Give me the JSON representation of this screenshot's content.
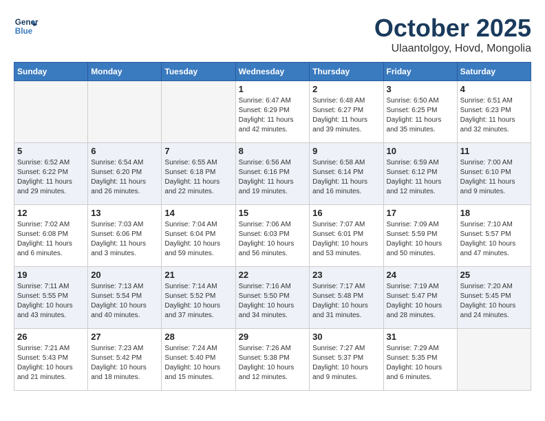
{
  "header": {
    "logo_line1": "General",
    "logo_line2": "Blue",
    "month": "October 2025",
    "location": "Ulaantolgoy, Hovd, Mongolia"
  },
  "weekdays": [
    "Sunday",
    "Monday",
    "Tuesday",
    "Wednesday",
    "Thursday",
    "Friday",
    "Saturday"
  ],
  "weeks": [
    [
      {
        "day": "",
        "info": ""
      },
      {
        "day": "",
        "info": ""
      },
      {
        "day": "",
        "info": ""
      },
      {
        "day": "1",
        "info": "Sunrise: 6:47 AM\nSunset: 6:29 PM\nDaylight: 11 hours\nand 42 minutes."
      },
      {
        "day": "2",
        "info": "Sunrise: 6:48 AM\nSunset: 6:27 PM\nDaylight: 11 hours\nand 39 minutes."
      },
      {
        "day": "3",
        "info": "Sunrise: 6:50 AM\nSunset: 6:25 PM\nDaylight: 11 hours\nand 35 minutes."
      },
      {
        "day": "4",
        "info": "Sunrise: 6:51 AM\nSunset: 6:23 PM\nDaylight: 11 hours\nand 32 minutes."
      }
    ],
    [
      {
        "day": "5",
        "info": "Sunrise: 6:52 AM\nSunset: 6:22 PM\nDaylight: 11 hours\nand 29 minutes."
      },
      {
        "day": "6",
        "info": "Sunrise: 6:54 AM\nSunset: 6:20 PM\nDaylight: 11 hours\nand 26 minutes."
      },
      {
        "day": "7",
        "info": "Sunrise: 6:55 AM\nSunset: 6:18 PM\nDaylight: 11 hours\nand 22 minutes."
      },
      {
        "day": "8",
        "info": "Sunrise: 6:56 AM\nSunset: 6:16 PM\nDaylight: 11 hours\nand 19 minutes."
      },
      {
        "day": "9",
        "info": "Sunrise: 6:58 AM\nSunset: 6:14 PM\nDaylight: 11 hours\nand 16 minutes."
      },
      {
        "day": "10",
        "info": "Sunrise: 6:59 AM\nSunset: 6:12 PM\nDaylight: 11 hours\nand 12 minutes."
      },
      {
        "day": "11",
        "info": "Sunrise: 7:00 AM\nSunset: 6:10 PM\nDaylight: 11 hours\nand 9 minutes."
      }
    ],
    [
      {
        "day": "12",
        "info": "Sunrise: 7:02 AM\nSunset: 6:08 PM\nDaylight: 11 hours\nand 6 minutes."
      },
      {
        "day": "13",
        "info": "Sunrise: 7:03 AM\nSunset: 6:06 PM\nDaylight: 11 hours\nand 3 minutes."
      },
      {
        "day": "14",
        "info": "Sunrise: 7:04 AM\nSunset: 6:04 PM\nDaylight: 10 hours\nand 59 minutes."
      },
      {
        "day": "15",
        "info": "Sunrise: 7:06 AM\nSunset: 6:03 PM\nDaylight: 10 hours\nand 56 minutes."
      },
      {
        "day": "16",
        "info": "Sunrise: 7:07 AM\nSunset: 6:01 PM\nDaylight: 10 hours\nand 53 minutes."
      },
      {
        "day": "17",
        "info": "Sunrise: 7:09 AM\nSunset: 5:59 PM\nDaylight: 10 hours\nand 50 minutes."
      },
      {
        "day": "18",
        "info": "Sunrise: 7:10 AM\nSunset: 5:57 PM\nDaylight: 10 hours\nand 47 minutes."
      }
    ],
    [
      {
        "day": "19",
        "info": "Sunrise: 7:11 AM\nSunset: 5:55 PM\nDaylight: 10 hours\nand 43 minutes."
      },
      {
        "day": "20",
        "info": "Sunrise: 7:13 AM\nSunset: 5:54 PM\nDaylight: 10 hours\nand 40 minutes."
      },
      {
        "day": "21",
        "info": "Sunrise: 7:14 AM\nSunset: 5:52 PM\nDaylight: 10 hours\nand 37 minutes."
      },
      {
        "day": "22",
        "info": "Sunrise: 7:16 AM\nSunset: 5:50 PM\nDaylight: 10 hours\nand 34 minutes."
      },
      {
        "day": "23",
        "info": "Sunrise: 7:17 AM\nSunset: 5:48 PM\nDaylight: 10 hours\nand 31 minutes."
      },
      {
        "day": "24",
        "info": "Sunrise: 7:19 AM\nSunset: 5:47 PM\nDaylight: 10 hours\nand 28 minutes."
      },
      {
        "day": "25",
        "info": "Sunrise: 7:20 AM\nSunset: 5:45 PM\nDaylight: 10 hours\nand 24 minutes."
      }
    ],
    [
      {
        "day": "26",
        "info": "Sunrise: 7:21 AM\nSunset: 5:43 PM\nDaylight: 10 hours\nand 21 minutes."
      },
      {
        "day": "27",
        "info": "Sunrise: 7:23 AM\nSunset: 5:42 PM\nDaylight: 10 hours\nand 18 minutes."
      },
      {
        "day": "28",
        "info": "Sunrise: 7:24 AM\nSunset: 5:40 PM\nDaylight: 10 hours\nand 15 minutes."
      },
      {
        "day": "29",
        "info": "Sunrise: 7:26 AM\nSunset: 5:38 PM\nDaylight: 10 hours\nand 12 minutes."
      },
      {
        "day": "30",
        "info": "Sunrise: 7:27 AM\nSunset: 5:37 PM\nDaylight: 10 hours\nand 9 minutes."
      },
      {
        "day": "31",
        "info": "Sunrise: 7:29 AM\nSunset: 5:35 PM\nDaylight: 10 hours\nand 6 minutes."
      },
      {
        "day": "",
        "info": ""
      }
    ]
  ]
}
